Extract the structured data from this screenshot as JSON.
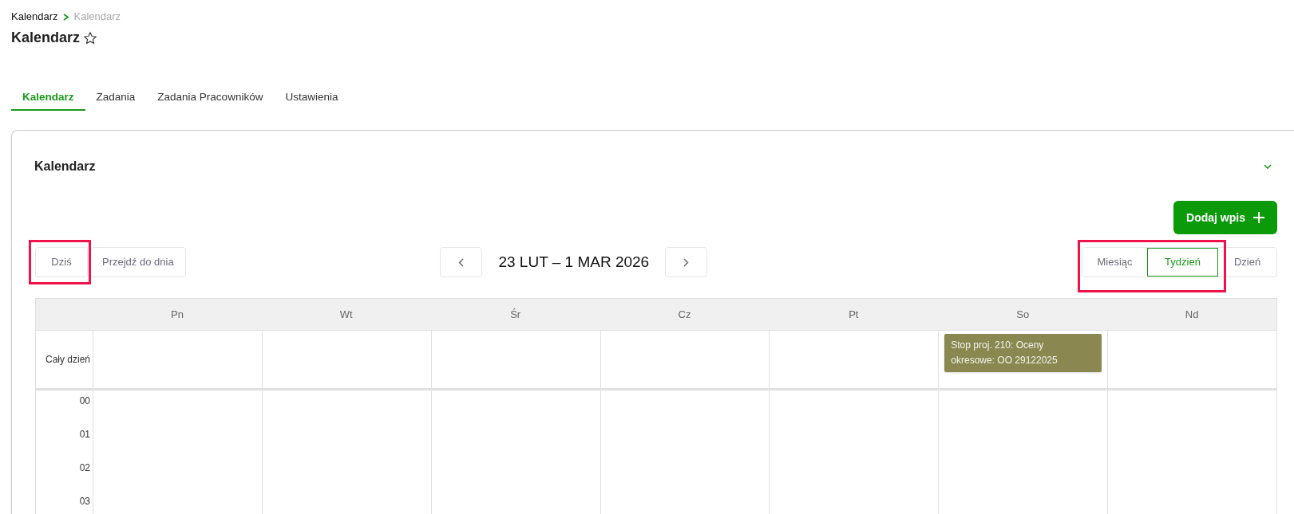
{
  "breadcrumb": [
    {
      "label": "Kalendarz",
      "current": false
    },
    {
      "label": "Kalendarz",
      "current": true
    }
  ],
  "page_title": "Kalendarz",
  "tabs": [
    {
      "label": "Kalendarz",
      "selected": true
    },
    {
      "label": "Zadania",
      "selected": false
    },
    {
      "label": "Zadania Pracowników",
      "selected": false
    },
    {
      "label": "Ustawienia",
      "selected": false
    }
  ],
  "section": {
    "title": "Kalendarz",
    "expanded": true
  },
  "add_button": "Dodaj wpis",
  "toolbar": {
    "today": {
      "label": "Dziś",
      "highlighted": true
    },
    "goto": "Przejdź do dnia",
    "range": "23 LUT – 1 MAR 2026",
    "views": [
      {
        "label": "Miesiąc",
        "selected": false
      },
      {
        "label": "Tydzień",
        "selected": true
      },
      {
        "label": "Dzień",
        "selected": false
      }
    ],
    "views_highlighted": true
  },
  "calendar": {
    "days": [
      {
        "label": "Pn"
      },
      {
        "label": "Wt"
      },
      {
        "label": "Śr"
      },
      {
        "label": "Cz"
      },
      {
        "label": "Pt"
      },
      {
        "label": "So",
        "all_day_events": [
          {
            "text": "Stop proj. 210: Oceny okresowe: OO 29122025",
            "color": "#8a8750"
          }
        ]
      },
      {
        "label": "Nd"
      }
    ],
    "all_day_label": "Cały dzień",
    "hours": [
      "00",
      "01",
      "02",
      "03"
    ]
  }
}
